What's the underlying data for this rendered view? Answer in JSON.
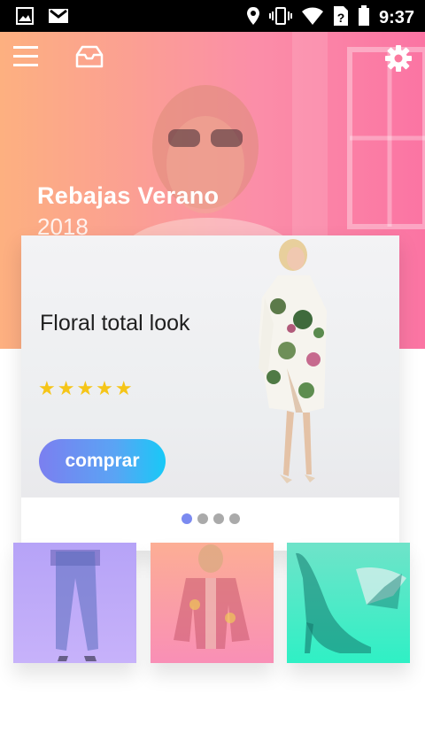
{
  "status_bar": {
    "time": "9:37",
    "icons": [
      "gallery-icon",
      "gmail-icon",
      "location-icon",
      "vibrate-icon",
      "wifi-icon",
      "no-sim-icon",
      "battery-icon"
    ]
  },
  "header": {
    "icons": [
      "menu-icon",
      "inbox-icon",
      "settings-icon"
    ]
  },
  "hero": {
    "title": "Rebajas Verano",
    "subtitle": "2018"
  },
  "product_card": {
    "title": "Floral total look",
    "rating": 5,
    "stars": "★★★★★",
    "buy_label": "comprar",
    "pager": {
      "total": 4,
      "active": 1
    }
  },
  "categories": {
    "tiles": [
      {
        "name": "jeans",
        "color": "#b9a5f8"
      },
      {
        "name": "kimono",
        "color": "#fb9fa8"
      },
      {
        "name": "heels",
        "color": "#3ee8c6"
      }
    ]
  },
  "colors": {
    "accent_start": "#7b7ff0",
    "accent_end": "#18c9f7",
    "star": "#f5c518",
    "hero_start": "#fdb080",
    "hero_end": "#fb74a3"
  }
}
